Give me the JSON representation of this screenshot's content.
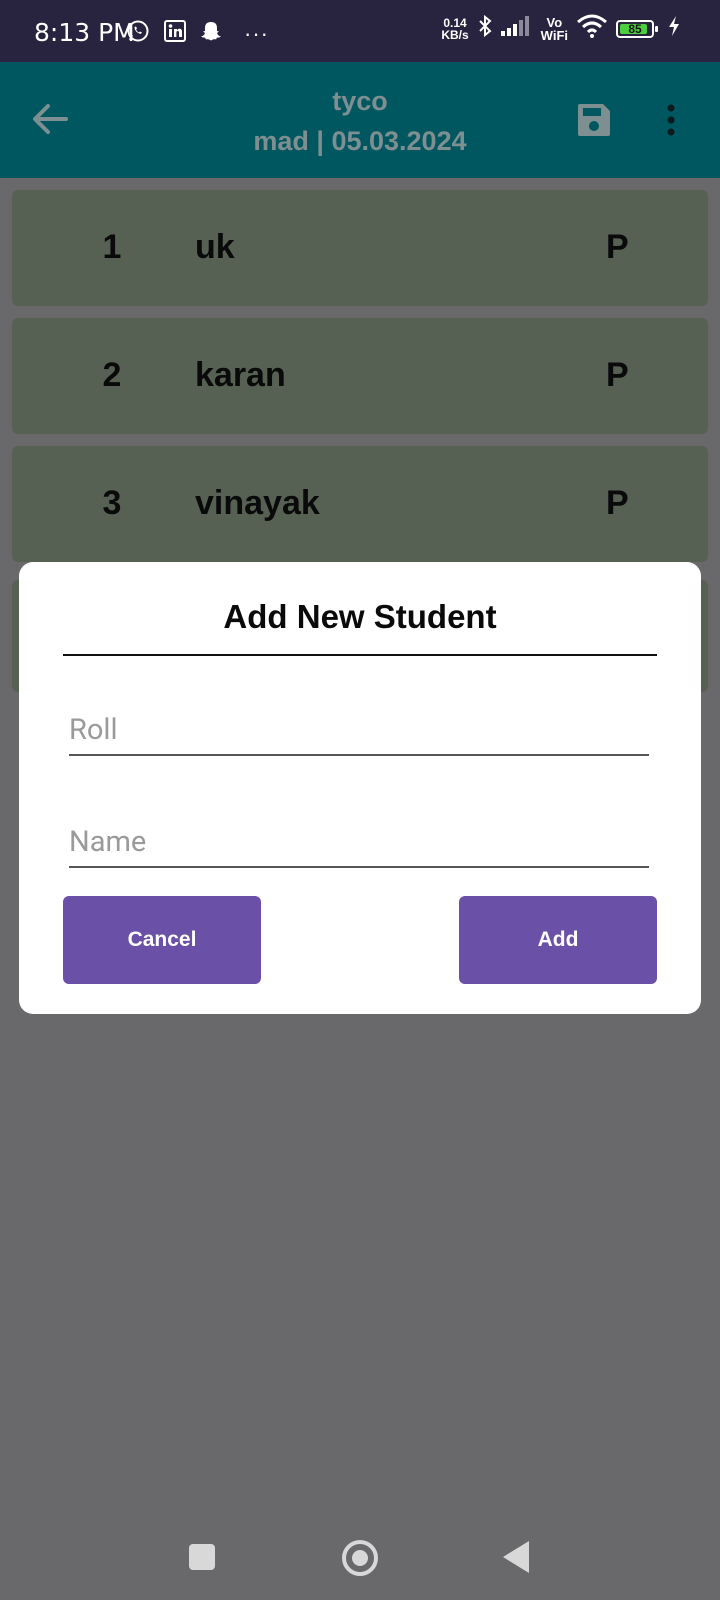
{
  "status_bar": {
    "time": "8:13 PM",
    "net_speed_value": "0.14",
    "net_speed_unit": "KB/s",
    "vo_label": "Vo",
    "wifi_label": "WiFi",
    "battery": "85",
    "overflow": "···"
  },
  "app_bar": {
    "title": "tyco",
    "subtitle": "mad | 05.03.2024"
  },
  "students": [
    {
      "roll": "1",
      "name": "uk",
      "status": "P"
    },
    {
      "roll": "2",
      "name": "karan",
      "status": "P"
    },
    {
      "roll": "3",
      "name": "vinayak",
      "status": "P"
    }
  ],
  "dialog": {
    "title": "Add New Student",
    "roll_placeholder": "Roll",
    "name_placeholder": "Name",
    "cancel_label": "Cancel",
    "add_label": "Add"
  },
  "colors": {
    "status_bar": "#28233f",
    "app_bar": "#01575f",
    "row_bg": "#566154",
    "dim_bg": "#69686b",
    "button": "#6a50a7"
  }
}
